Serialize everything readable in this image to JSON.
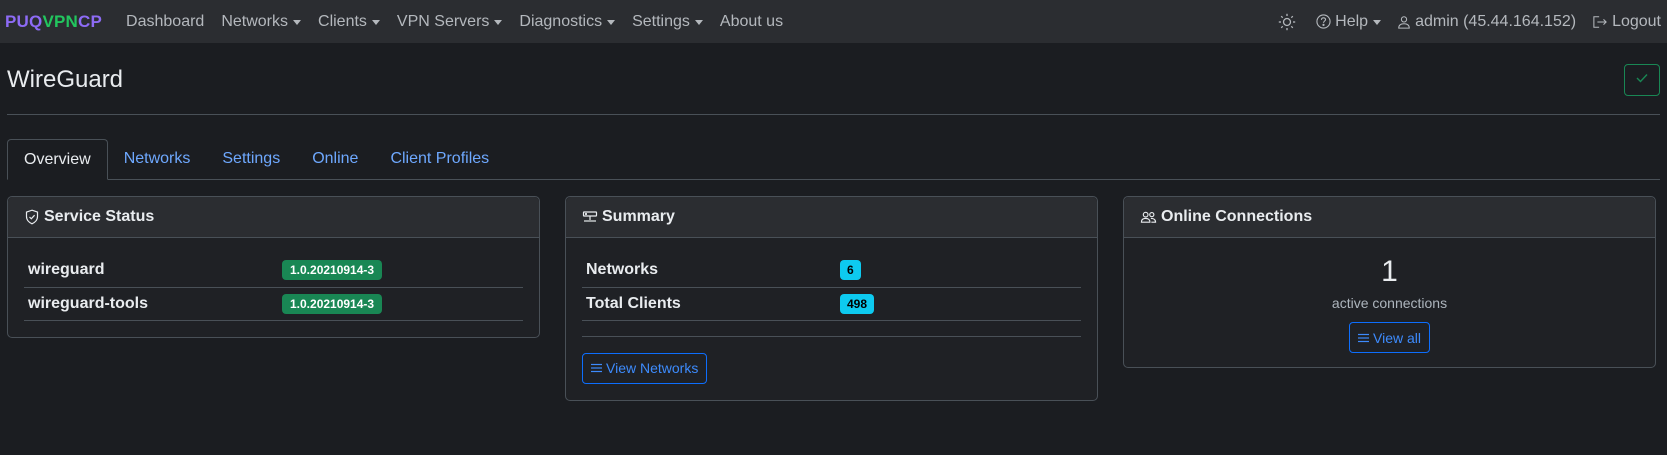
{
  "navbar": {
    "brand": {
      "part1": "PUQ",
      "part2": "VPN",
      "part3": "CP"
    },
    "links": [
      {
        "label": "Dashboard",
        "dropdown": false
      },
      {
        "label": "Networks",
        "dropdown": true
      },
      {
        "label": "Clients",
        "dropdown": true
      },
      {
        "label": "VPN Servers",
        "dropdown": true
      },
      {
        "label": "Diagnostics",
        "dropdown": true
      },
      {
        "label": "Settings",
        "dropdown": true
      },
      {
        "label": "About us",
        "dropdown": false
      }
    ],
    "right": {
      "theme_icon": "sun-icon",
      "help_label": "Help",
      "user_label": "admin (45.44.164.152)",
      "logout_label": "Logout"
    }
  },
  "page": {
    "title": "WireGuard",
    "status_icon": "check-icon"
  },
  "tabs": [
    {
      "label": "Overview",
      "active": true
    },
    {
      "label": "Networks",
      "active": false
    },
    {
      "label": "Settings",
      "active": false
    },
    {
      "label": "Online",
      "active": false
    },
    {
      "label": "Client Profiles",
      "active": false
    }
  ],
  "service_status": {
    "title": "Service Status",
    "icon": "shield-check-icon",
    "rows": [
      {
        "name": "wireguard",
        "version": "1.0.20210914-3"
      },
      {
        "name": "wireguard-tools",
        "version": "1.0.20210914-3"
      }
    ]
  },
  "summary": {
    "title": "Summary",
    "icon": "server-icon",
    "rows": [
      {
        "name": "Networks",
        "value": "6"
      },
      {
        "name": "Total Clients",
        "value": "498"
      }
    ],
    "button_label": "View Networks"
  },
  "online": {
    "title": "Online Connections",
    "icon": "people-icon",
    "count": "1",
    "count_label": "active connections",
    "button_label": "View all"
  },
  "colors": {
    "brand_purple": "#8d6bf5",
    "brand_green": "#22c55e",
    "link_blue": "#6ea8fe",
    "badge_green": "#198754",
    "badge_cyan": "#0dcaf0"
  }
}
